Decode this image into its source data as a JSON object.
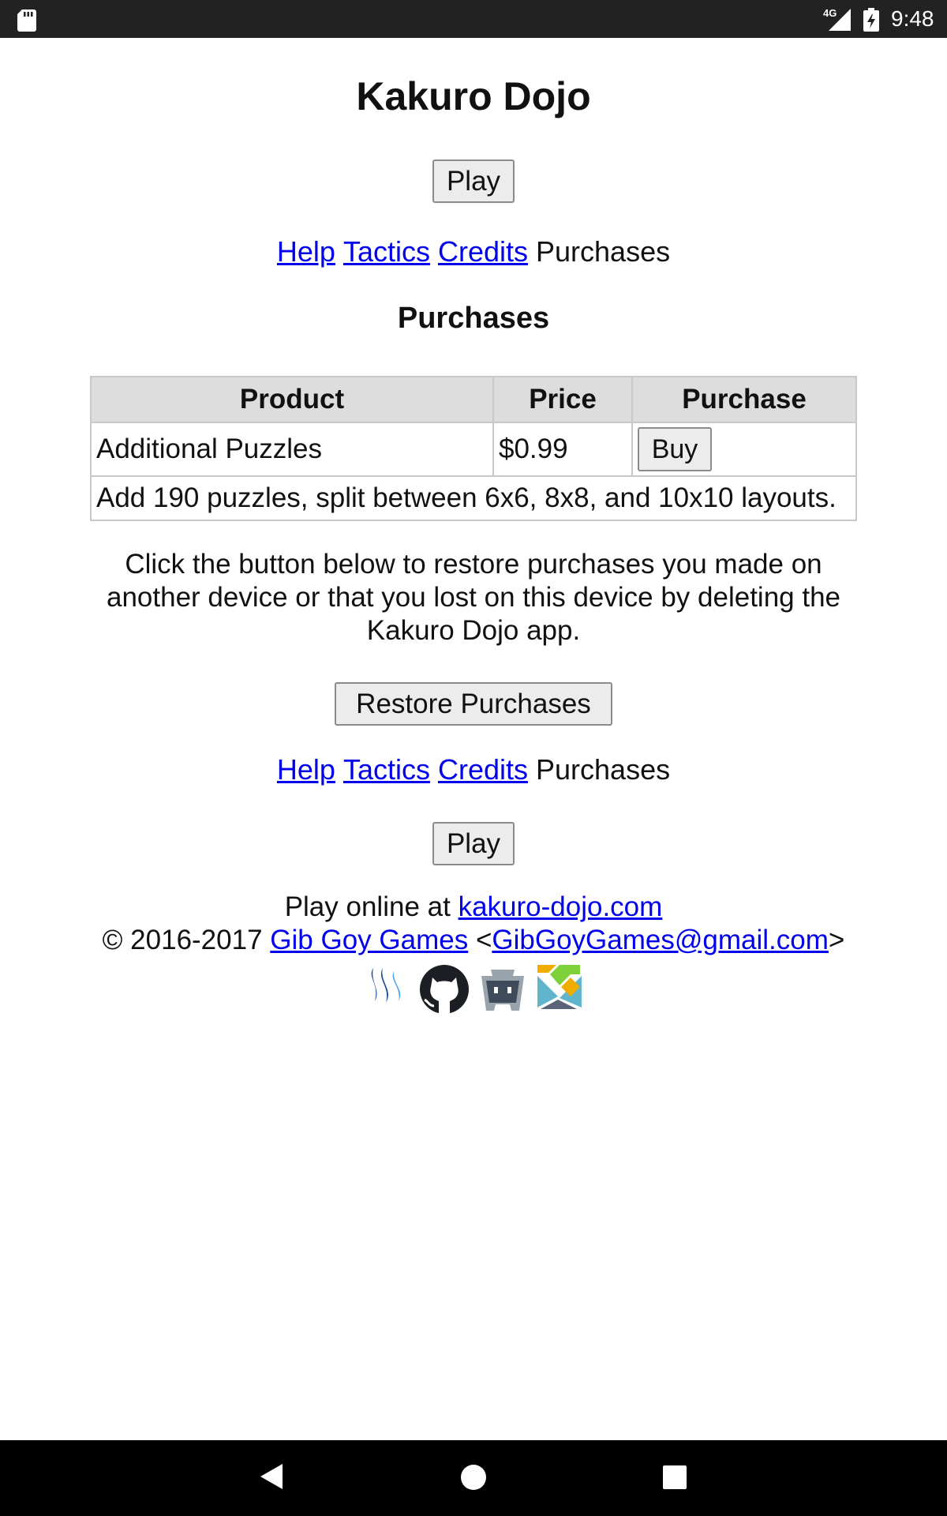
{
  "status_bar": {
    "network_label": "4G",
    "time": "9:48",
    "icons": [
      "sd-card-icon",
      "signal-icon",
      "battery-icon"
    ]
  },
  "page": {
    "title": "Kakuro Dojo",
    "play_label": "Play",
    "nav": {
      "help": "Help",
      "tactics": "Tactics",
      "credits": "Credits",
      "purchases": "Purchases"
    },
    "section_title": "Purchases",
    "table": {
      "headers": [
        "Product",
        "Price",
        "Purchase"
      ],
      "rows": [
        {
          "product": "Additional Puzzles",
          "price": "$0.99",
          "button": "Buy"
        }
      ],
      "description": "Add 190 puzzles, split between 6x6, 8x8, and 10x10 layouts."
    },
    "restore_text": "Click the button below to restore purchases you made on another device or that you lost on this device by deleting the Kakuro Dojo app.",
    "restore_button": "Restore Purchases",
    "footer": {
      "play_online_prefix": "Play online at",
      "website": "kakuro-dojo.com",
      "copyright": "© 2016-2017",
      "company": "Gib Goy Games",
      "email_open": "<",
      "email": "GibGoyGames@gmail.com",
      "email_close": ">",
      "icons": [
        "steemit-icon",
        "github-icon",
        "cordova-icon",
        "elm-icon"
      ]
    }
  },
  "nav_bar": {
    "buttons": [
      "back-icon",
      "home-icon",
      "recents-icon"
    ]
  },
  "colors": {
    "link": "#0000ee",
    "status_bar_bg": "#222222",
    "table_header_bg": "#dddddd",
    "button_bg": "#ececec"
  }
}
